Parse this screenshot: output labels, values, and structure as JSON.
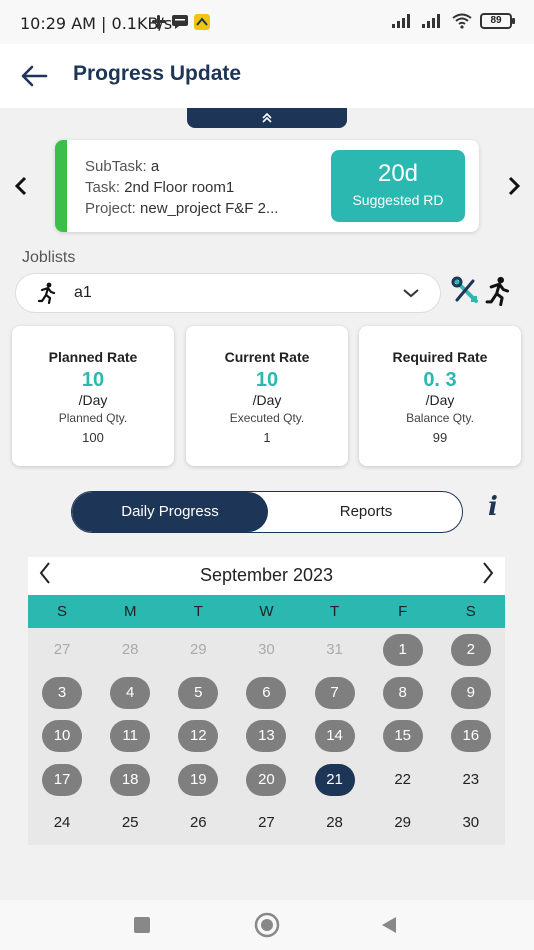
{
  "status_bar": {
    "time": "10:29 AM | 0.1KB/s",
    "battery": "89"
  },
  "header": {
    "title": "Progress Update"
  },
  "task_card": {
    "subtask_label": "SubTask:",
    "subtask_value": "a",
    "task_label": "Task:",
    "task_value": "2nd Floor room1",
    "project_label": "Project:",
    "project_value": "new_project F&F 2...",
    "rd_value": "20d",
    "rd_label": "Suggested RD"
  },
  "joblists": {
    "label": "Joblists",
    "selected": "a1"
  },
  "rates": [
    {
      "title": "Planned Rate",
      "value": "10",
      "unit": "/Day",
      "qty_label": "Planned Qty.",
      "qty": "100"
    },
    {
      "title": "Current Rate",
      "value": "10",
      "unit": "/Day",
      "qty_label": "Executed Qty.",
      "qty": "1"
    },
    {
      "title": "Required Rate",
      "value": "0. 3",
      "unit": "/Day",
      "qty_label": "Balance Qty.",
      "qty": "99"
    }
  ],
  "tabs": {
    "daily": "Daily Progress",
    "reports": "Reports"
  },
  "info_glyph": "i",
  "calendar": {
    "month": "September  2023",
    "weekdays": [
      "S",
      "M",
      "T",
      "W",
      "T",
      "F",
      "S"
    ],
    "weeks": [
      [
        {
          "d": "27",
          "s": "muted"
        },
        {
          "d": "28",
          "s": "muted"
        },
        {
          "d": "29",
          "s": "muted"
        },
        {
          "d": "30",
          "s": "muted"
        },
        {
          "d": "31",
          "s": "muted"
        },
        {
          "d": "1",
          "s": "done"
        },
        {
          "d": "2",
          "s": "done"
        }
      ],
      [
        {
          "d": "3",
          "s": "done"
        },
        {
          "d": "4",
          "s": "done"
        },
        {
          "d": "5",
          "s": "done"
        },
        {
          "d": "6",
          "s": "done"
        },
        {
          "d": "7",
          "s": "done"
        },
        {
          "d": "8",
          "s": "done"
        },
        {
          "d": "9",
          "s": "done"
        }
      ],
      [
        {
          "d": "10",
          "s": "done"
        },
        {
          "d": "11",
          "s": "done"
        },
        {
          "d": "12",
          "s": "done"
        },
        {
          "d": "13",
          "s": "done"
        },
        {
          "d": "14",
          "s": "done"
        },
        {
          "d": "15",
          "s": "done"
        },
        {
          "d": "16",
          "s": "done"
        }
      ],
      [
        {
          "d": "17",
          "s": "done"
        },
        {
          "d": "18",
          "s": "done"
        },
        {
          "d": "19",
          "s": "done"
        },
        {
          "d": "20",
          "s": "done"
        },
        {
          "d": "21",
          "s": "today"
        },
        {
          "d": "22",
          "s": "future"
        },
        {
          "d": "23",
          "s": "future"
        }
      ],
      [
        {
          "d": "24",
          "s": "future"
        },
        {
          "d": "25",
          "s": "future"
        },
        {
          "d": "26",
          "s": "future"
        },
        {
          "d": "27",
          "s": "future"
        },
        {
          "d": "28",
          "s": "future"
        },
        {
          "d": "29",
          "s": "future"
        },
        {
          "d": "30",
          "s": "future"
        }
      ]
    ]
  },
  "colors": {
    "primary": "#1d3557",
    "accent": "#2bb8b0",
    "green": "#3cbf4a",
    "done_day": "#7f7f7f"
  }
}
